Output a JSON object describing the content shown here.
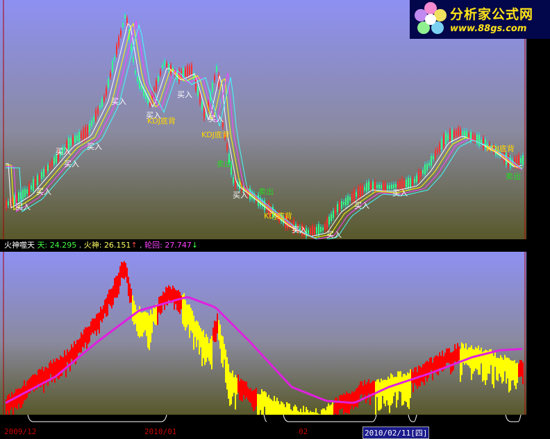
{
  "watermark": {
    "title": "分析家公式网",
    "url": "www.88gs.com"
  },
  "main_chart": {
    "signals": [
      {
        "text": "买入",
        "color": "#ffffff"
      },
      {
        "text": "买入",
        "color": "#ffffff"
      },
      {
        "text": "买入",
        "color": "#ffffff"
      },
      {
        "text": "买入",
        "color": "#ffffff"
      },
      {
        "text": "买入",
        "color": "#ffffff"
      },
      {
        "text": "买入",
        "color": "#ffffff"
      },
      {
        "text": "买入",
        "color": "#ffffff"
      },
      {
        "text": "买入",
        "color": "#ffffff"
      },
      {
        "text": "买入",
        "color": "#ffffff"
      },
      {
        "text": "KDJ底背",
        "color": "#ffd700"
      },
      {
        "text": "KDJ底背",
        "color": "#ffd700"
      },
      {
        "text": "KDJ底背",
        "color": "#ffd700"
      },
      {
        "text": "KDJ底背",
        "color": "#ffd700"
      },
      {
        "text": "买入",
        "color": "#ffffff"
      },
      {
        "text": "买入",
        "color": "#ffffff"
      },
      {
        "text": "买入",
        "color": "#ffffff"
      },
      {
        "text": "买入",
        "color": "#ffffff"
      },
      {
        "text": "买入",
        "color": "#ffffff"
      },
      {
        "text": "卖出",
        "color": "#22dd22"
      },
      {
        "text": "卖出",
        "color": "#22dd22"
      },
      {
        "text": "卖出",
        "color": "#22dd22"
      }
    ]
  },
  "indicator": {
    "name": "火神噬天",
    "items": [
      {
        "label": "天:",
        "value": "24.295",
        "arrow": "",
        "color": "#44ff44"
      },
      {
        "label": "火神:",
        "value": "26.151",
        "arrow": "↑",
        "color": "#ffff66"
      },
      {
        "label": "轮回:",
        "value": "27.747",
        "arrow": "↓",
        "color": "#ff44ff"
      }
    ]
  },
  "date_axis": {
    "labels": [
      "2009/12",
      "2010/01",
      "02"
    ],
    "cursor": "2010/02/11[四]"
  },
  "colors": {
    "panel_top": "#8a8ef0",
    "panel_bottom": "#5a5a1e",
    "rise": "#ff0000",
    "fall": "#ffff00",
    "ma": "#ff00ff"
  }
}
